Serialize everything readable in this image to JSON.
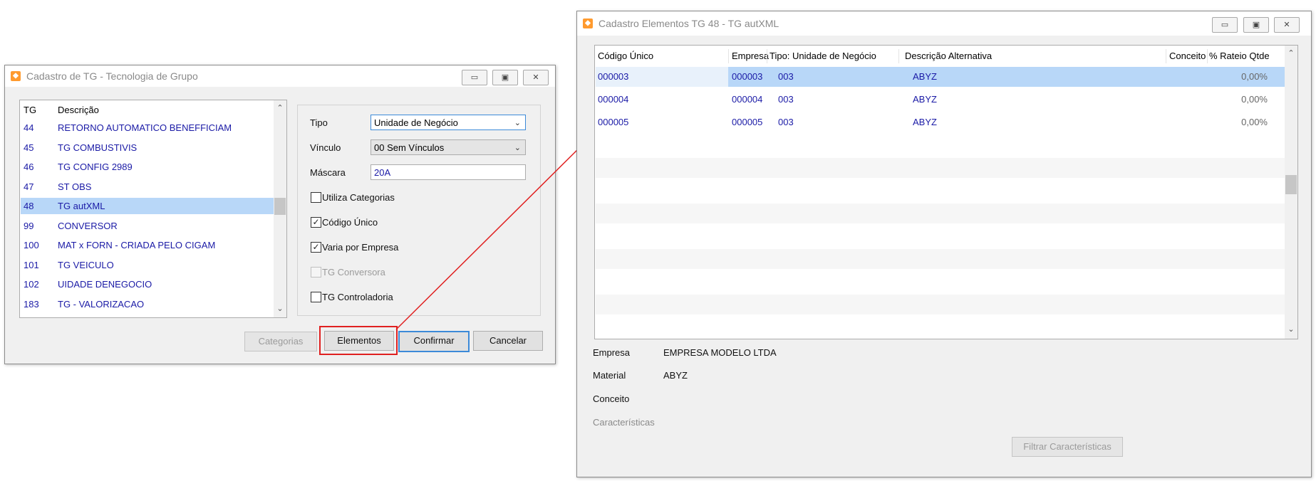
{
  "window1": {
    "title": "Cadastro de TG - Tecnologia de Grupo",
    "list": {
      "col_tg": "TG",
      "col_desc": "Descrição",
      "rows": [
        {
          "tg": "44",
          "desc": "RETORNO AUTOMATICO BENEFFICIAM"
        },
        {
          "tg": "45",
          "desc": "TG COMBUSTIVIS"
        },
        {
          "tg": "46",
          "desc": "TG CONFIG 2989"
        },
        {
          "tg": "47",
          "desc": "ST OBS"
        },
        {
          "tg": "48",
          "desc": "TG autXML"
        },
        {
          "tg": "99",
          "desc": "CONVERSOR"
        },
        {
          "tg": "100",
          "desc": "MAT x FORN - CRIADA PELO CIGAM"
        },
        {
          "tg": "101",
          "desc": "TG VEICULO"
        },
        {
          "tg": "102",
          "desc": "UIDADE DENEGOCIO"
        },
        {
          "tg": "183",
          "desc": "TG - VALORIZACAO"
        }
      ]
    },
    "form": {
      "tipo_label": "Tipo",
      "tipo_value": "Unidade de Negócio",
      "vinculo_label": "Vínculo",
      "vinculo_value": "00 Sem Vínculos",
      "mascara_label": "Máscara",
      "mascara_value": "20A",
      "utiliza_categorias": "Utiliza Categorias",
      "codigo_unico": "Código Único",
      "varia_por_empresa": "Varia por Empresa",
      "tg_conversora": "TG Conversora",
      "tg_controladoria": "TG Controladoria"
    },
    "buttons": {
      "categorias": "Categorias",
      "elementos": "Elementos",
      "confirmar": "Confirmar",
      "cancelar": "Cancelar"
    }
  },
  "window2": {
    "title": "Cadastro Elementos TG 48 - TG autXML",
    "grid": {
      "headers": {
        "codigo": "Código Único",
        "empresa": "Empresa",
        "tipo": "Tipo: Unidade de Negócio",
        "descricao": "Descrição Alternativa",
        "conceito": "Conceito",
        "rateio": "% Rateio Qtde"
      },
      "rows": [
        {
          "codigo": "000003",
          "empresa": "000003",
          "tipo": "003",
          "descricao": "ABYZ",
          "conceito": "",
          "rateio": "0,00%"
        },
        {
          "codigo": "000004",
          "empresa": "000004",
          "tipo": "003",
          "descricao": "ABYZ",
          "conceito": "",
          "rateio": "0,00%"
        },
        {
          "codigo": "000005",
          "empresa": "000005",
          "tipo": "003",
          "descricao": "ABYZ",
          "conceito": "",
          "rateio": "0,00%"
        }
      ]
    },
    "details": {
      "empresa_label": "Empresa",
      "empresa_value": "EMPRESA MODELO LTDA",
      "material_label": "Material",
      "material_value": "ABYZ",
      "conceito_label": "Conceito",
      "caracteristicas_label": "Características"
    },
    "buttons": {
      "filtrar": "Filtrar Características"
    }
  },
  "icons": {
    "minimize": "minimize-icon",
    "maximize": "maximize-icon",
    "close": "close-icon",
    "app": "cigam-app-icon"
  },
  "colors": {
    "selection": "#b8d7f8",
    "data_text": "#1a1aa6",
    "highlight_border": "#e02020",
    "focus_border": "#3c8ad8"
  }
}
